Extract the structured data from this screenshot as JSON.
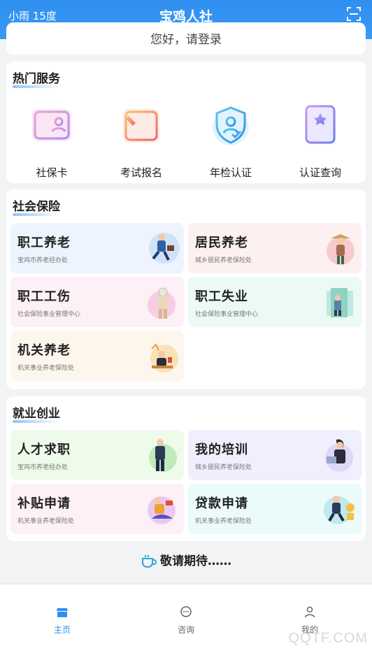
{
  "header": {
    "weather": "小雨 15度",
    "title": "宝鸡人社"
  },
  "login": {
    "text": "您好，请登录"
  },
  "hot_services": {
    "title": "热门服务",
    "items": [
      {
        "label": "社保卡",
        "icon": "social-card-icon"
      },
      {
        "label": "考试报名",
        "icon": "exam-register-icon"
      },
      {
        "label": "年检认证",
        "icon": "annual-check-icon"
      },
      {
        "label": "认证查询",
        "icon": "cert-query-icon"
      }
    ]
  },
  "social_insurance": {
    "title": "社会保险",
    "tiles": [
      {
        "title": "职工养老",
        "sub": "宝鸡市养老经办处",
        "bg": "#edf4fd"
      },
      {
        "title": "居民养老",
        "sub": "城乡居民养老保险处",
        "bg": "#fdf0f0"
      },
      {
        "title": "职工工伤",
        "sub": "社会保险事业管理中心",
        "bg": "#fdf0f7"
      },
      {
        "title": "职工失业",
        "sub": "社会保险事业管理中心",
        "bg": "#ecfaf6"
      },
      {
        "title": "机关养老",
        "sub": "机关事业养老保险处",
        "bg": "#fdf6ec"
      }
    ]
  },
  "employment": {
    "title": "就业创业",
    "tiles": [
      {
        "title": "人才求职",
        "sub": "宝鸡市养老经办处",
        "bg": "#eefbea"
      },
      {
        "title": "我的培训",
        "sub": "城乡居民养老保险处",
        "bg": "#f0effd"
      },
      {
        "title": "补贴申请",
        "sub": "机关事业养老保险处",
        "bg": "#fdf0f7"
      },
      {
        "title": "贷款申请",
        "sub": "机关事业养老保险处",
        "bg": "#ebfafb"
      }
    ]
  },
  "coming_soon": {
    "text": "敬请期待……"
  },
  "tabbar": {
    "items": [
      {
        "label": "主页",
        "icon": "home-icon",
        "active": true
      },
      {
        "label": "咨询",
        "icon": "chat-icon",
        "active": false
      },
      {
        "label": "我的",
        "icon": "user-icon",
        "active": false
      }
    ]
  },
  "watermark": "QQTF.COM",
  "colors": {
    "primary": "#2f8ff0",
    "background": "#f2f3f5"
  }
}
